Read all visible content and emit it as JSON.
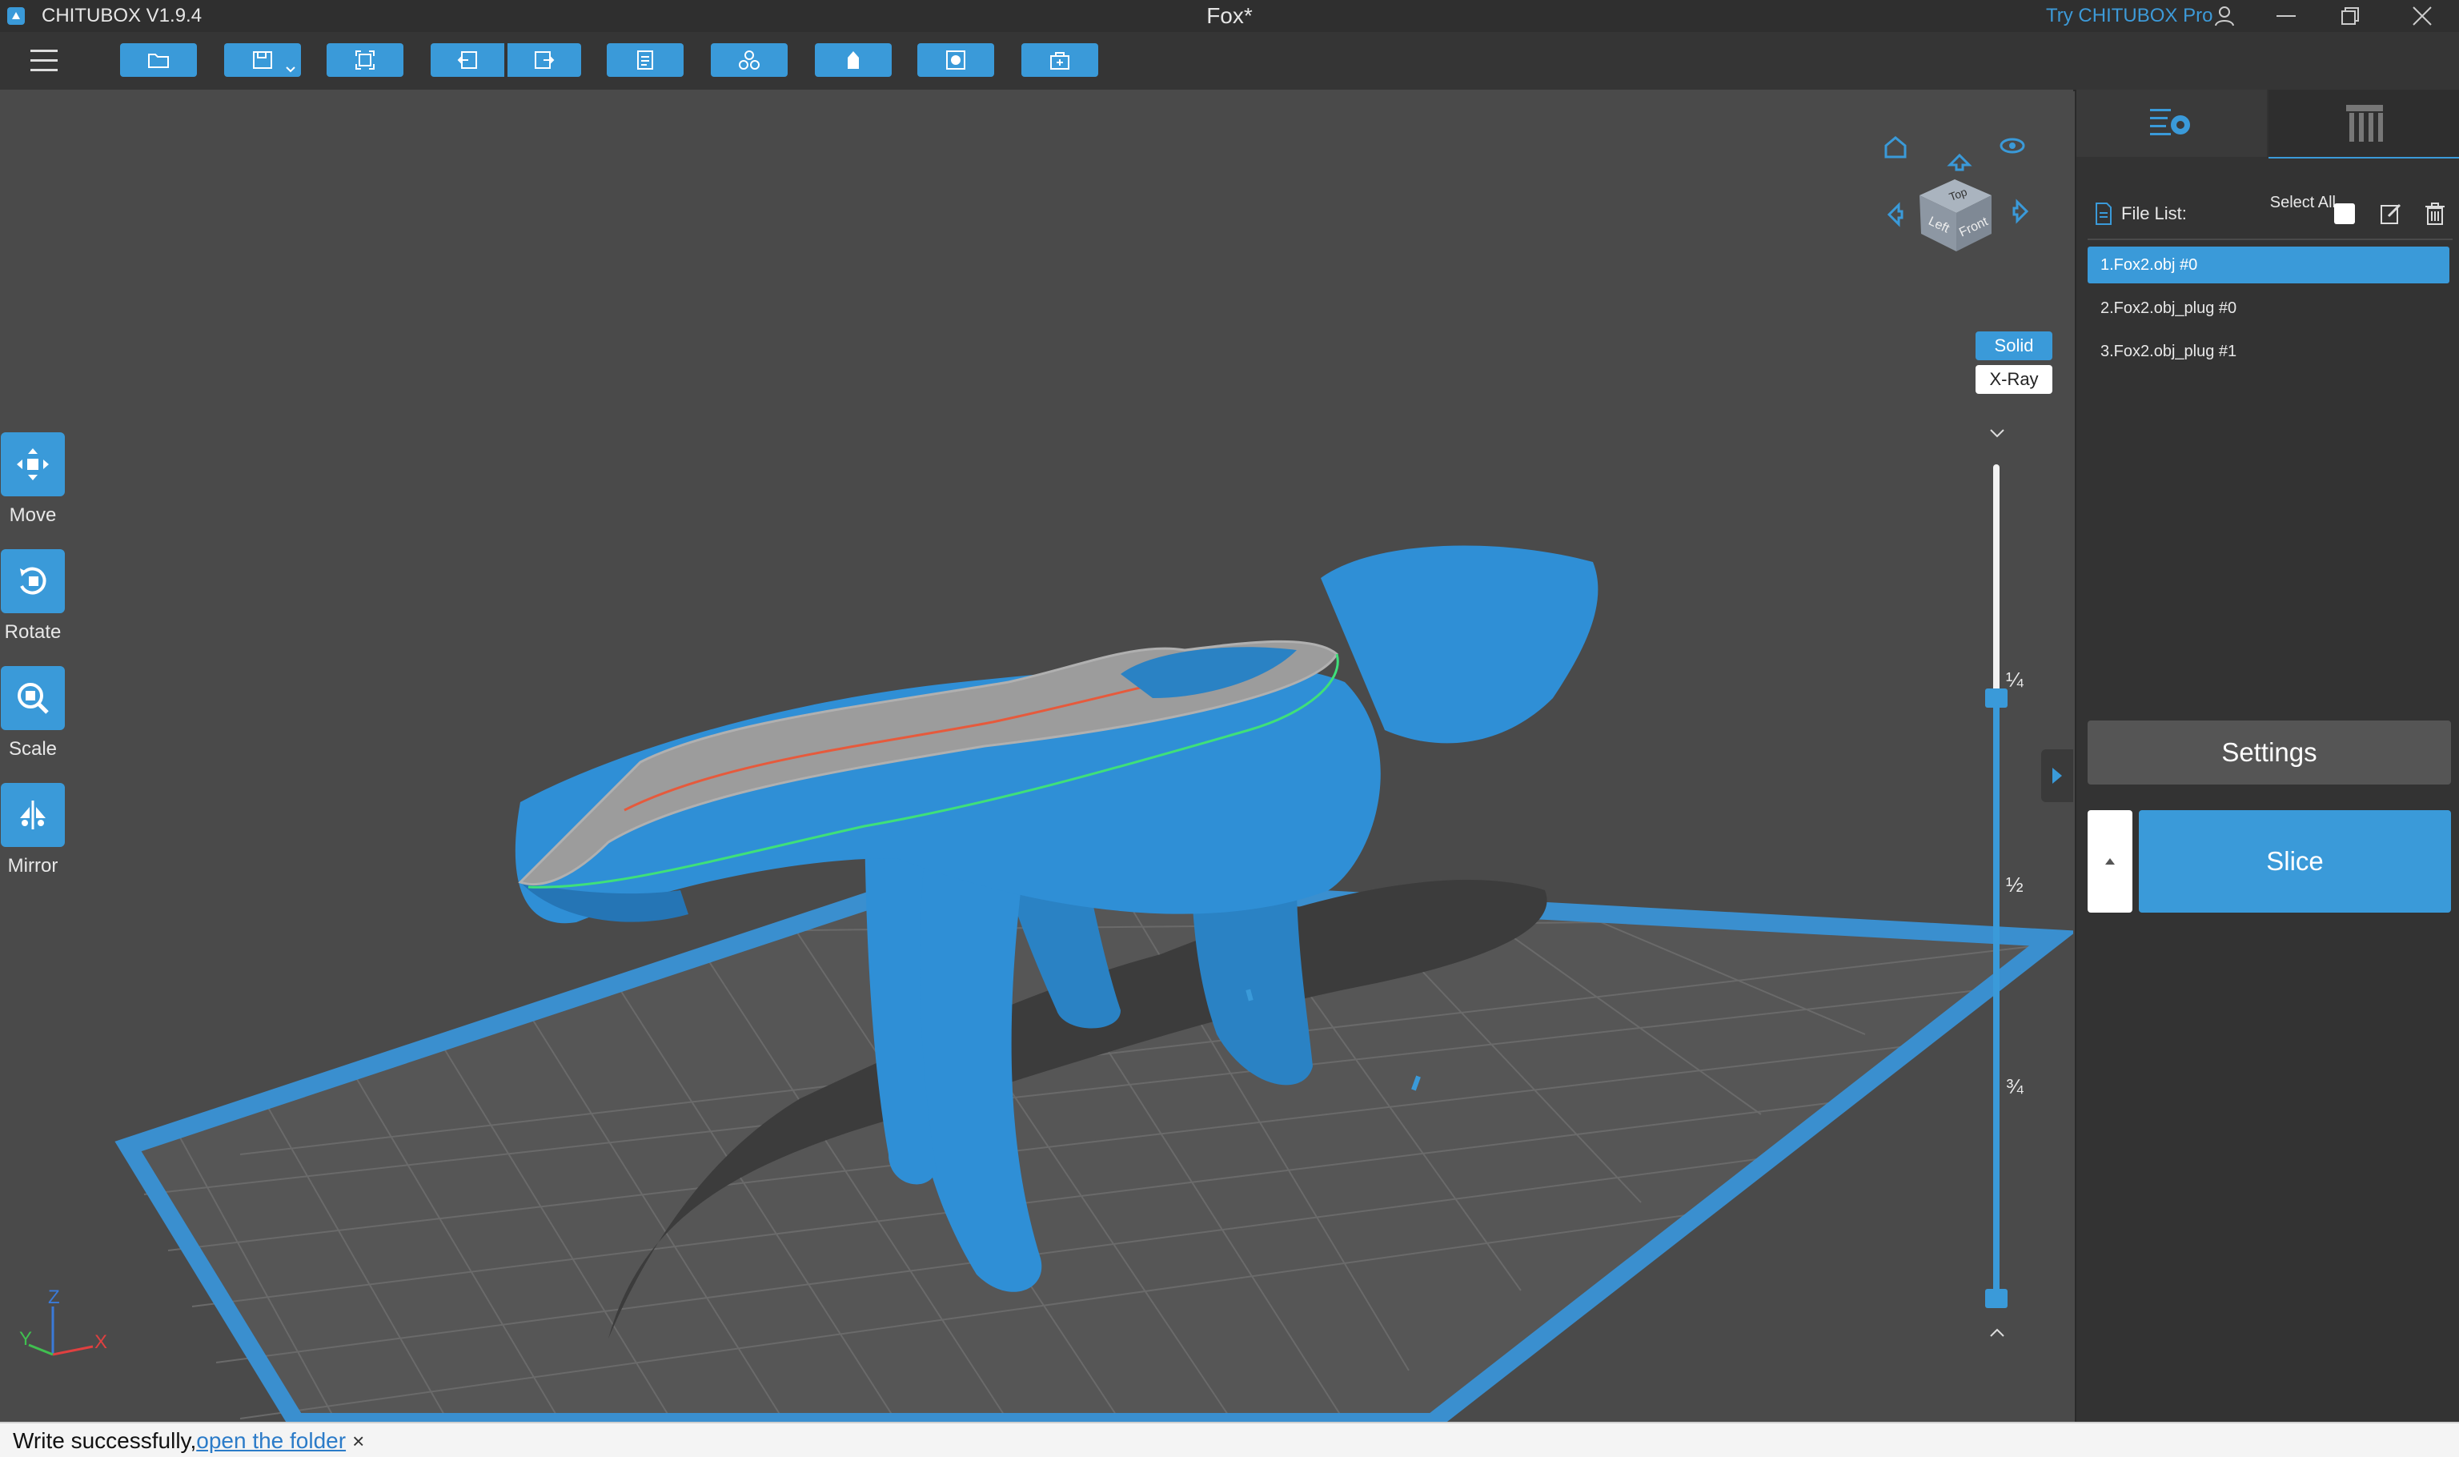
{
  "app": {
    "title": "CHITUBOX V1.9.4",
    "document_title": "Fox*",
    "try_pro": "Try CHITUBOX Pro"
  },
  "tools": [
    {
      "label": "Move"
    },
    {
      "label": "Rotate"
    },
    {
      "label": "Scale"
    },
    {
      "label": "Mirror"
    }
  ],
  "view_cube": {
    "top": "Top",
    "left": "Left",
    "front": "Front"
  },
  "render_mode": {
    "solid": "Solid",
    "xray": "X-Ray",
    "selected": "Solid"
  },
  "layer_slider": {
    "ticks": [
      "¼",
      "½",
      "¾"
    ],
    "upper_value_fraction": 0.26,
    "lower_value_fraction": 1.0
  },
  "axes": {
    "x": "X",
    "y": "Y",
    "z": "Z"
  },
  "panel": {
    "file_list_label": "File List:",
    "select_all": "Select All",
    "select_all_checked": false,
    "files": [
      {
        "name": "1.Fox2.obj #0",
        "selected": true
      },
      {
        "name": "2.Fox2.obj_plug #0",
        "selected": false
      },
      {
        "name": "3.Fox2.obj_plug #1",
        "selected": false
      }
    ],
    "settings_label": "Settings",
    "slice_label": "Slice"
  },
  "status": {
    "message": "Write successfully,",
    "link": "open the folder",
    "close": "×"
  },
  "colors": {
    "accent": "#3a9ad9",
    "model": "#2f8fd6",
    "background": "#4a4a4a",
    "panel": "#333333"
  }
}
